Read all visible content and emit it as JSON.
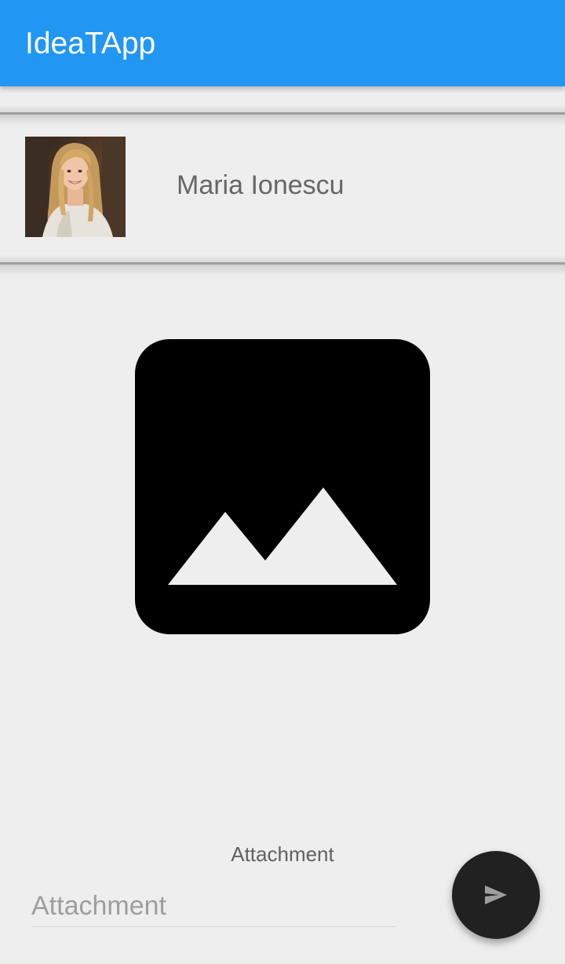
{
  "app_bar": {
    "title": "IdeaTApp",
    "color": "#2196f3"
  },
  "profile": {
    "name": "Maria Ionescu",
    "avatar_icon": "user-photo"
  },
  "preview": {
    "icon": "image-placeholder-icon"
  },
  "attachment": {
    "label": "Attachment",
    "placeholder": "Attachment",
    "value": ""
  },
  "fab": {
    "icon": "send-icon",
    "color": "#212121"
  }
}
